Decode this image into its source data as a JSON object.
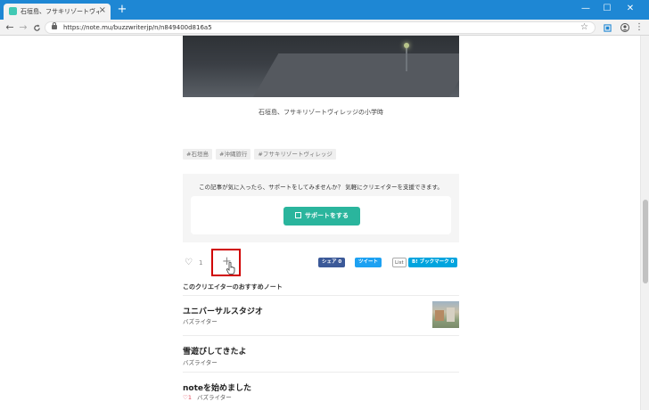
{
  "browser": {
    "tab_title": "石垣島、フサキリゾートヴィレッジの宿泊...",
    "tab_close": "×",
    "new_tab": "+",
    "window_minimize": "—",
    "window_maximize": "☐",
    "window_close": "✕",
    "back": "←",
    "forward": "→",
    "reload": "C",
    "url": "https://note.mu/buzzwriterjp/n/n849400d816a5",
    "bookmark_star": "☆",
    "menu": "⋮"
  },
  "article": {
    "photo_caption": "石垣島、フサキリゾートヴィレッジの小学時",
    "tags": [
      "#石垣島",
      "#沖縄旅行",
      "#フサキリゾートヴィレッジ"
    ]
  },
  "support": {
    "prompt": "この記事が気に入ったら、サポートをしてみませんか？ 気軽にクリエイターを支援できます。",
    "button_label": "サポートをする"
  },
  "engagement": {
    "like_count": "1",
    "add_symbol": "+",
    "share_facebook": "シェア 0",
    "share_twitter": "ツイート",
    "share_list": "List",
    "share_hatena": "B! ブックマーク 0"
  },
  "recommendations": {
    "heading": "このクリエイターのおすすめノート",
    "notes": [
      {
        "title": "ユニバーサルスタジオ",
        "author": "バズライター"
      },
      {
        "title": "雪遊びしてきたよ",
        "author": "バズライター"
      },
      {
        "title": "noteを始めました",
        "author": "バズライター",
        "likes": "1"
      }
    ]
  },
  "colors": {
    "chrome_blue": "#1e87d4",
    "support_green": "#2ab59d",
    "highlight_red": "#d00000"
  }
}
